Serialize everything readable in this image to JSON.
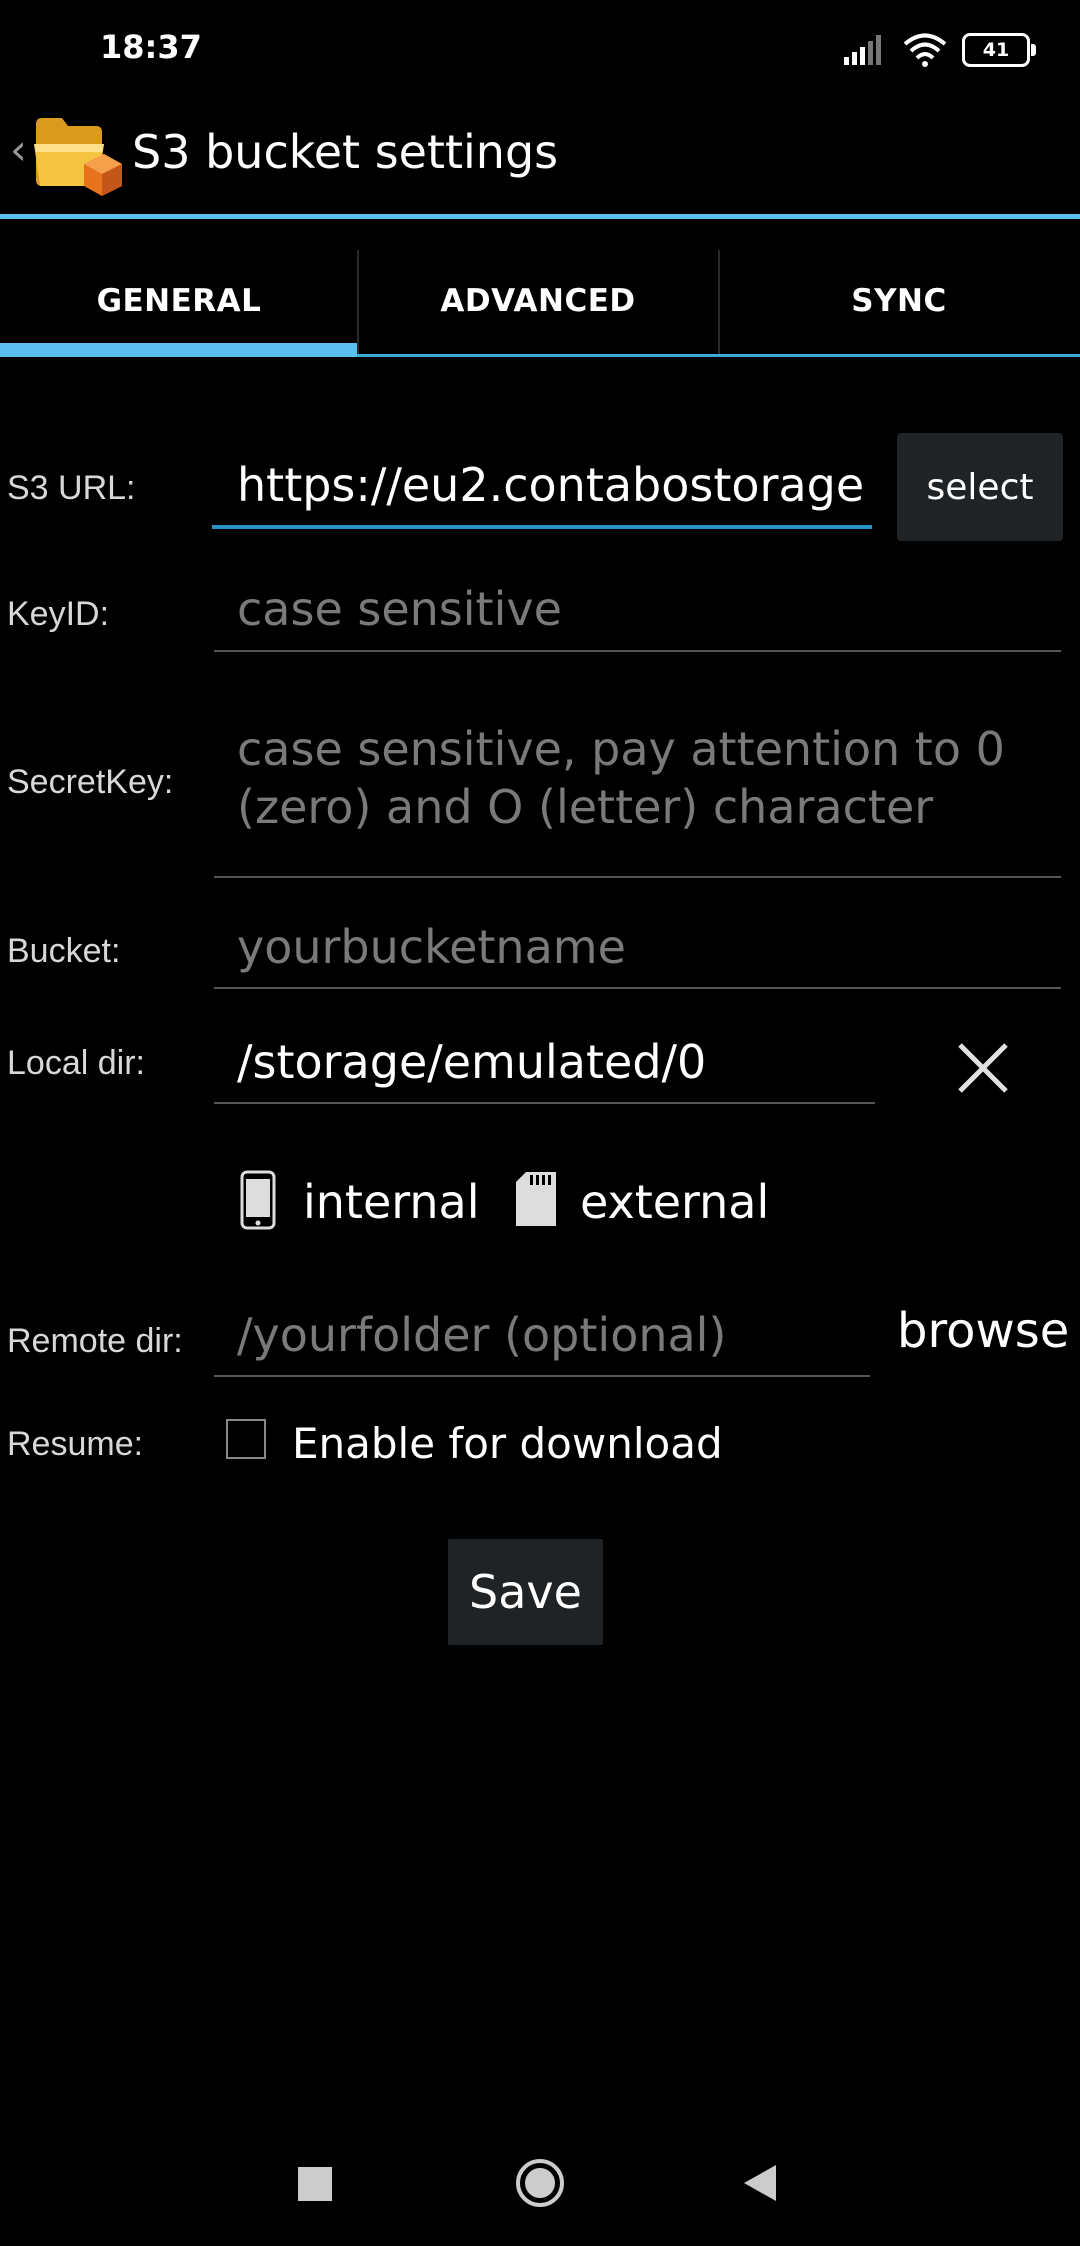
{
  "status_bar": {
    "time": "18:37",
    "battery": "41"
  },
  "header": {
    "back": "‹",
    "title": "S3 bucket settings"
  },
  "tabs": [
    {
      "label": "GENERAL",
      "selected": true
    },
    {
      "label": "ADVANCED",
      "selected": false
    },
    {
      "label": "SYNC",
      "selected": false
    }
  ],
  "form": {
    "s3_url": {
      "label": "S3 URL:",
      "value": "https://eu2.contabostorage",
      "button": "select"
    },
    "key_id": {
      "label": "KeyID:",
      "placeholder": "case sensitive"
    },
    "secret_key": {
      "label": "SecretKey:",
      "placeholder_line1": "case sensitive, pay attention to 0",
      "placeholder_line2": "(zero) and O (letter) character"
    },
    "bucket": {
      "label": "Bucket:",
      "placeholder": "yourbucketname"
    },
    "local_dir": {
      "label": "Local dir:",
      "value": "/storage/emulated/0",
      "clear_icon": "close-icon"
    },
    "storage_options": {
      "internal": "internal",
      "external": "external"
    },
    "remote_dir": {
      "label": "Remote dir:",
      "placeholder": "/yourfolder (optional)",
      "button": "browse"
    },
    "resume": {
      "label": "Resume:",
      "checkbox_label": "Enable for download",
      "checked": false
    }
  },
  "save_button": "Save",
  "colors": {
    "accent": "#5bc0f0",
    "background": "#000000",
    "button_bg": "#202325"
  }
}
